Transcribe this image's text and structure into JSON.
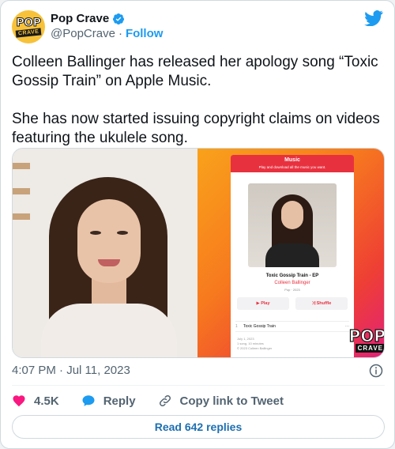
{
  "author": {
    "display_name": "Pop Crave",
    "handle": "@PopCrave",
    "separator": "·",
    "follow_label": "Follow",
    "avatar_text_top": "POP",
    "avatar_text_bottom": "CRAVE",
    "verified": true
  },
  "tweet": {
    "paragraphs": [
      "Colleen Ballinger has released her apology song “Toxic Gossip Train” on Apple Music.",
      "She has now started issuing copyright claims on videos featuring the ukulele song."
    ]
  },
  "media": {
    "left_photo_icon": "portrait-photo",
    "apple_music": {
      "brand": "Music",
      "banner_subtitle": "Play and download all the music you want.",
      "album_title": "Toxic Gossip Train - EP",
      "artist": "Colleen Ballinger",
      "genre_year": "Pop · 2023",
      "play_label": "▶ Play",
      "shuffle_label": "⤨ Shuffle",
      "track_number": "1",
      "track_title": "Toxic Gossip Train",
      "track_more": "···",
      "release_date": "July 1, 2023",
      "song_count": "1 song, 10 minutes",
      "copyright": "© 2023 Colleen Ballinger"
    },
    "watermark_top": "POP",
    "watermark_bottom": "CRAVE"
  },
  "timestamp": "4:07 PM · Jul 11, 2023",
  "actions": {
    "like_count": "4.5K",
    "reply_label": "Reply",
    "copy_link_label": "Copy link to Tweet"
  },
  "read_replies_label": "Read 642 replies",
  "colors": {
    "accent": "#1d9bf0",
    "like": "#f91880",
    "text": "#0f1419",
    "muted": "#536471"
  }
}
